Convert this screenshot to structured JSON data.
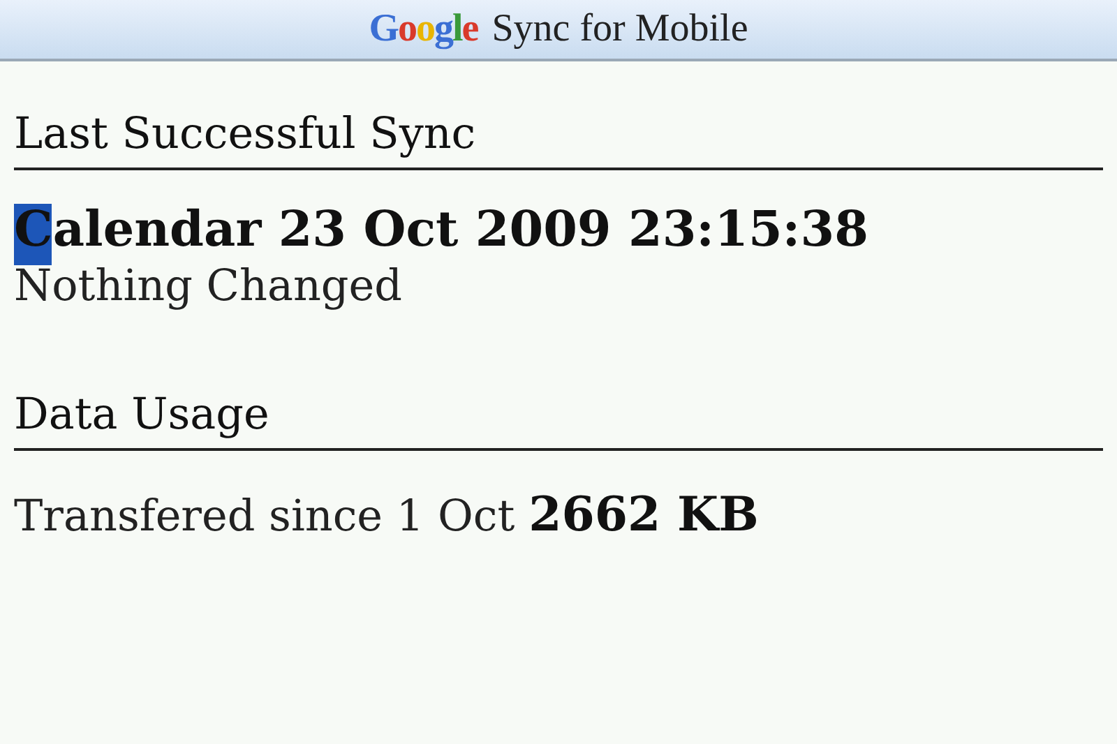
{
  "title_bar": {
    "logo": "Google",
    "title": "Sync for Mobile"
  },
  "sections": [
    {
      "heading": "Last Successful Sync",
      "kind": "sync",
      "entry": "Calendar 23 Oct 2009 23:15:38",
      "cursor": true,
      "status": "Nothing Changed"
    },
    {
      "heading": "Data Usage",
      "kind": "usage",
      "text": "Transfered since 1 Oct **2662 KB**"
    }
  ]
}
